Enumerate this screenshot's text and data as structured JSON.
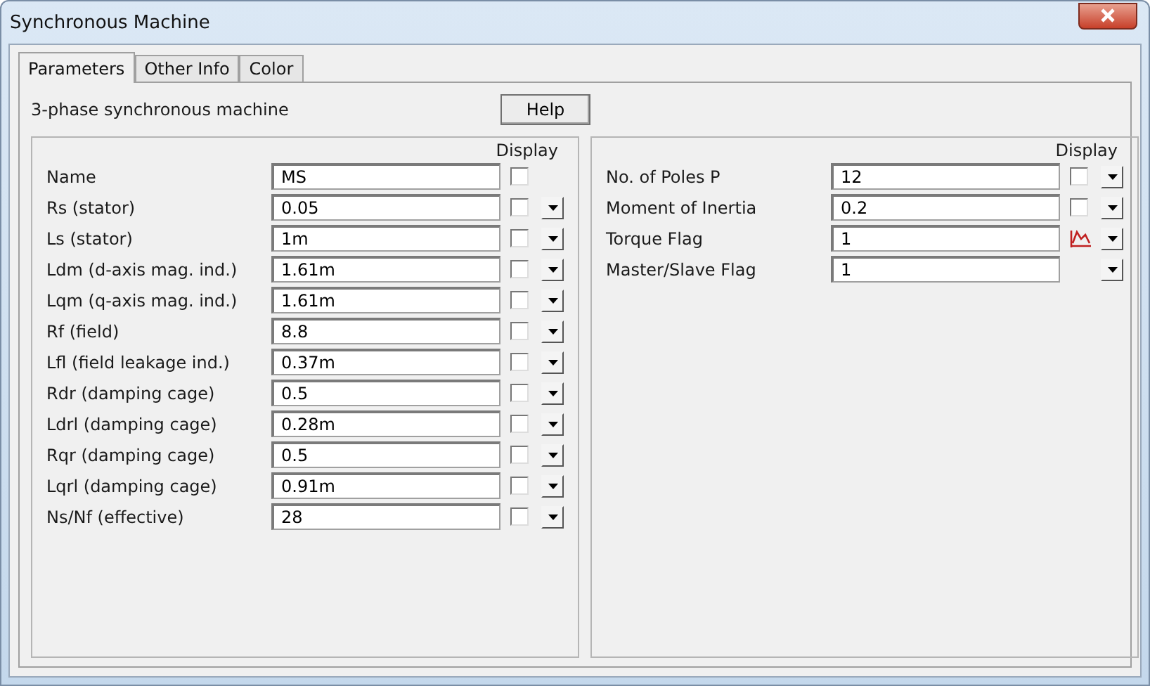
{
  "window": {
    "title": "Synchronous Machine"
  },
  "tabs": [
    {
      "label": "Parameters",
      "selected": true
    },
    {
      "label": "Other Info",
      "selected": false
    },
    {
      "label": "Color",
      "selected": false
    }
  ],
  "description": "3-phase synchronous machine",
  "help_button": "Help",
  "panels": [
    {
      "display_header": "Display",
      "params": [
        {
          "label": "Name",
          "value": "MS",
          "kind": "checkbox",
          "checked": false,
          "dropdown": false
        },
        {
          "label": "Rs (stator)",
          "value": "0.05",
          "kind": "checkbox",
          "checked": false,
          "dropdown": true
        },
        {
          "label": "Ls (stator)",
          "value": "1m",
          "kind": "checkbox",
          "checked": false,
          "dropdown": true
        },
        {
          "label": "Ldm (d-axis mag. ind.)",
          "value": "1.61m",
          "kind": "checkbox",
          "checked": false,
          "dropdown": true
        },
        {
          "label": "Lqm (q-axis mag. ind.)",
          "value": "1.61m",
          "kind": "checkbox",
          "checked": false,
          "dropdown": true
        },
        {
          "label": "Rf (field)",
          "value": "8.8",
          "kind": "checkbox",
          "checked": false,
          "dropdown": true
        },
        {
          "label": "Lfl (field leakage ind.)",
          "value": "0.37m",
          "kind": "checkbox",
          "checked": false,
          "dropdown": true
        },
        {
          "label": "Rdr (damping cage)",
          "value": "0.5",
          "kind": "checkbox",
          "checked": false,
          "dropdown": true
        },
        {
          "label": "Ldrl (damping cage)",
          "value": "0.28m",
          "kind": "checkbox",
          "checked": false,
          "dropdown": true
        },
        {
          "label": "Rqr (damping cage)",
          "value": "0.5",
          "kind": "checkbox",
          "checked": false,
          "dropdown": true
        },
        {
          "label": "Lqrl (damping cage)",
          "value": "0.91m",
          "kind": "checkbox",
          "checked": false,
          "dropdown": true
        },
        {
          "label": "Ns/Nf (effective)",
          "value": "28",
          "kind": "checkbox",
          "checked": false,
          "dropdown": true
        }
      ]
    },
    {
      "display_header": "Display",
      "params": [
        {
          "label": "No. of Poles P",
          "value": "12",
          "kind": "checkbox",
          "checked": false,
          "dropdown": true
        },
        {
          "label": "Moment of Inertia",
          "value": "0.2",
          "kind": "checkbox",
          "checked": false,
          "dropdown": true
        },
        {
          "label": "Torque Flag",
          "value": "1",
          "kind": "scope",
          "dropdown": true
        },
        {
          "label": "Master/Slave Flag",
          "value": "1",
          "kind": "none",
          "dropdown": true
        }
      ]
    }
  ]
}
